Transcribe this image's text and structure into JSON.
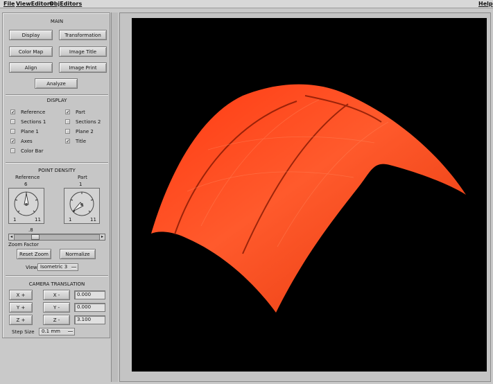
{
  "menu": {
    "file": "File",
    "view_editors": "ViewEditors",
    "obj_editors": "ObjEditors",
    "help": "Help"
  },
  "main": {
    "title": "MAIN",
    "display": "Display",
    "transformation": "Transformation",
    "color_map": "Color Map",
    "image_title": "Image Title",
    "align": "Align",
    "image_print": "Image Print",
    "analyze": "Analyze"
  },
  "display": {
    "title": "DISPLAY",
    "items": [
      {
        "label": "Reference",
        "checked": true
      },
      {
        "label": "Part",
        "checked": true
      },
      {
        "label": "Sections 1",
        "checked": false
      },
      {
        "label": "Sections 2",
        "checked": false
      },
      {
        "label": "Plane 1",
        "checked": false
      },
      {
        "label": "Plane 2",
        "checked": false
      },
      {
        "label": "Axes",
        "checked": true
      },
      {
        "label": "Title",
        "checked": true
      },
      {
        "label": "Color Bar",
        "checked": false
      }
    ],
    "check_mark": "✓"
  },
  "point_density": {
    "title": "POINT DENSITY",
    "reference": {
      "label": "Reference",
      "value": "6",
      "min": "1",
      "max": "11"
    },
    "part": {
      "label": "Part",
      "value": "1",
      "min": "1",
      "max": "11"
    }
  },
  "zoom": {
    "value": ".8",
    "label": "Zoom Factor",
    "fraction": 0.22,
    "reset_label": "Reset Zoom",
    "normalize_label": "Normalize"
  },
  "view": {
    "label": "View",
    "selected": "Isometric 3"
  },
  "camera": {
    "title": "CAMERA TRANSLATION",
    "x_plus": "X +",
    "x_minus": "X -",
    "x_value": "0.000",
    "y_plus": "Y +",
    "y_minus": "Y -",
    "y_value": "0.000",
    "z_plus": "Z +",
    "z_minus": "Z -",
    "z_value": "3.100",
    "step_label": "Step Size",
    "step_value": "0.1 mm"
  },
  "colors": {
    "surface": "#ff4a1c",
    "background": "#000000",
    "panel": "#c6c6c6"
  }
}
